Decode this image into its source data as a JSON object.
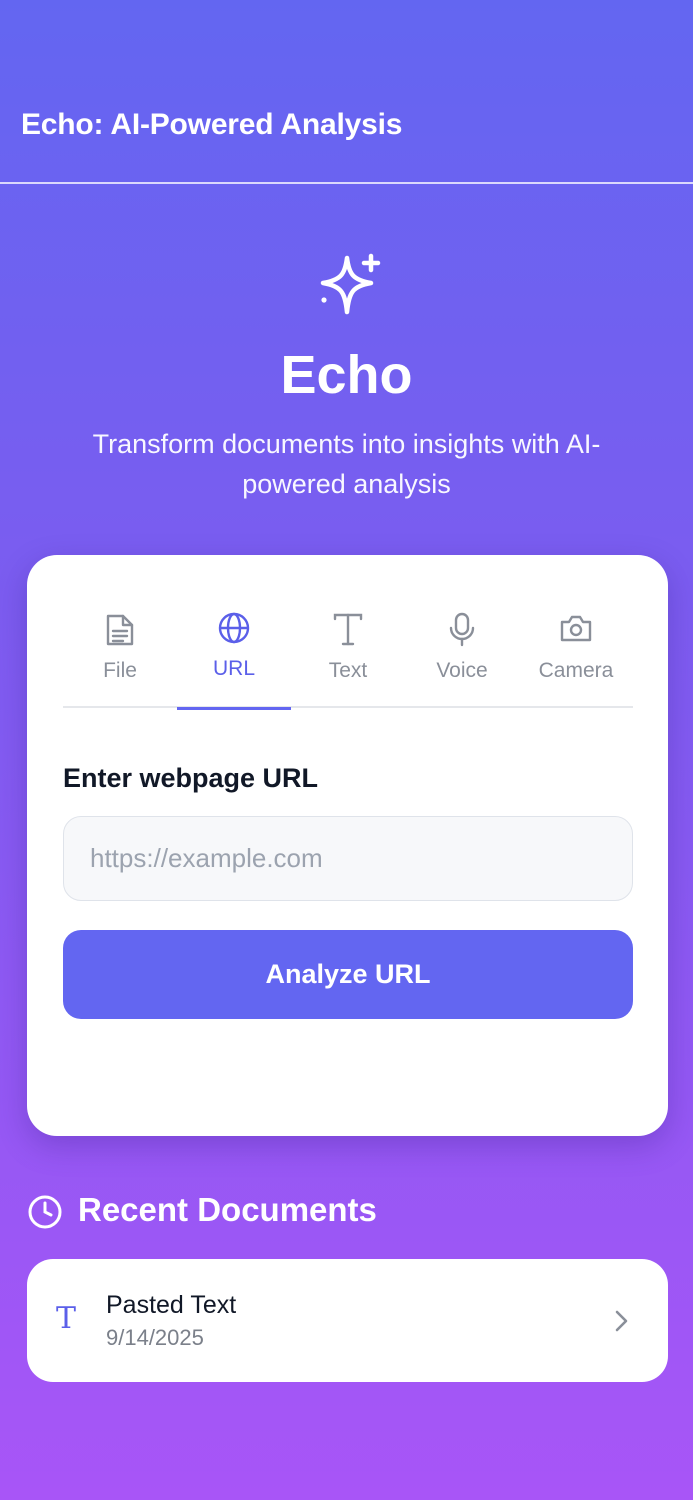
{
  "header": {
    "title": "Echo: AI-Powered Analysis"
  },
  "hero": {
    "icon": "sparkles-icon",
    "title": "Echo",
    "subtitle": "Transform documents into insights with AI-powered analysis"
  },
  "tabs": [
    {
      "label": "File",
      "icon": "file-icon",
      "active": false
    },
    {
      "label": "URL",
      "icon": "globe-icon",
      "active": true
    },
    {
      "label": "Text",
      "icon": "text-icon",
      "active": false
    },
    {
      "label": "Voice",
      "icon": "microphone-icon",
      "active": false
    },
    {
      "label": "Camera",
      "icon": "camera-icon",
      "active": false
    }
  ],
  "url_form": {
    "label": "Enter webpage URL",
    "placeholder": "https://example.com",
    "value": "",
    "button_label": "Analyze URL"
  },
  "recent": {
    "title": "Recent Documents",
    "icon": "clock-icon",
    "items": [
      {
        "name": "Pasted Text",
        "date": "9/14/2025",
        "type_icon": "T",
        "action_icon": "chevron-right-icon"
      }
    ]
  },
  "colors": {
    "accent": "#6366f1",
    "gradient_top": "#6366f1",
    "gradient_bottom": "#a855f7",
    "card_bg": "#ffffff"
  }
}
